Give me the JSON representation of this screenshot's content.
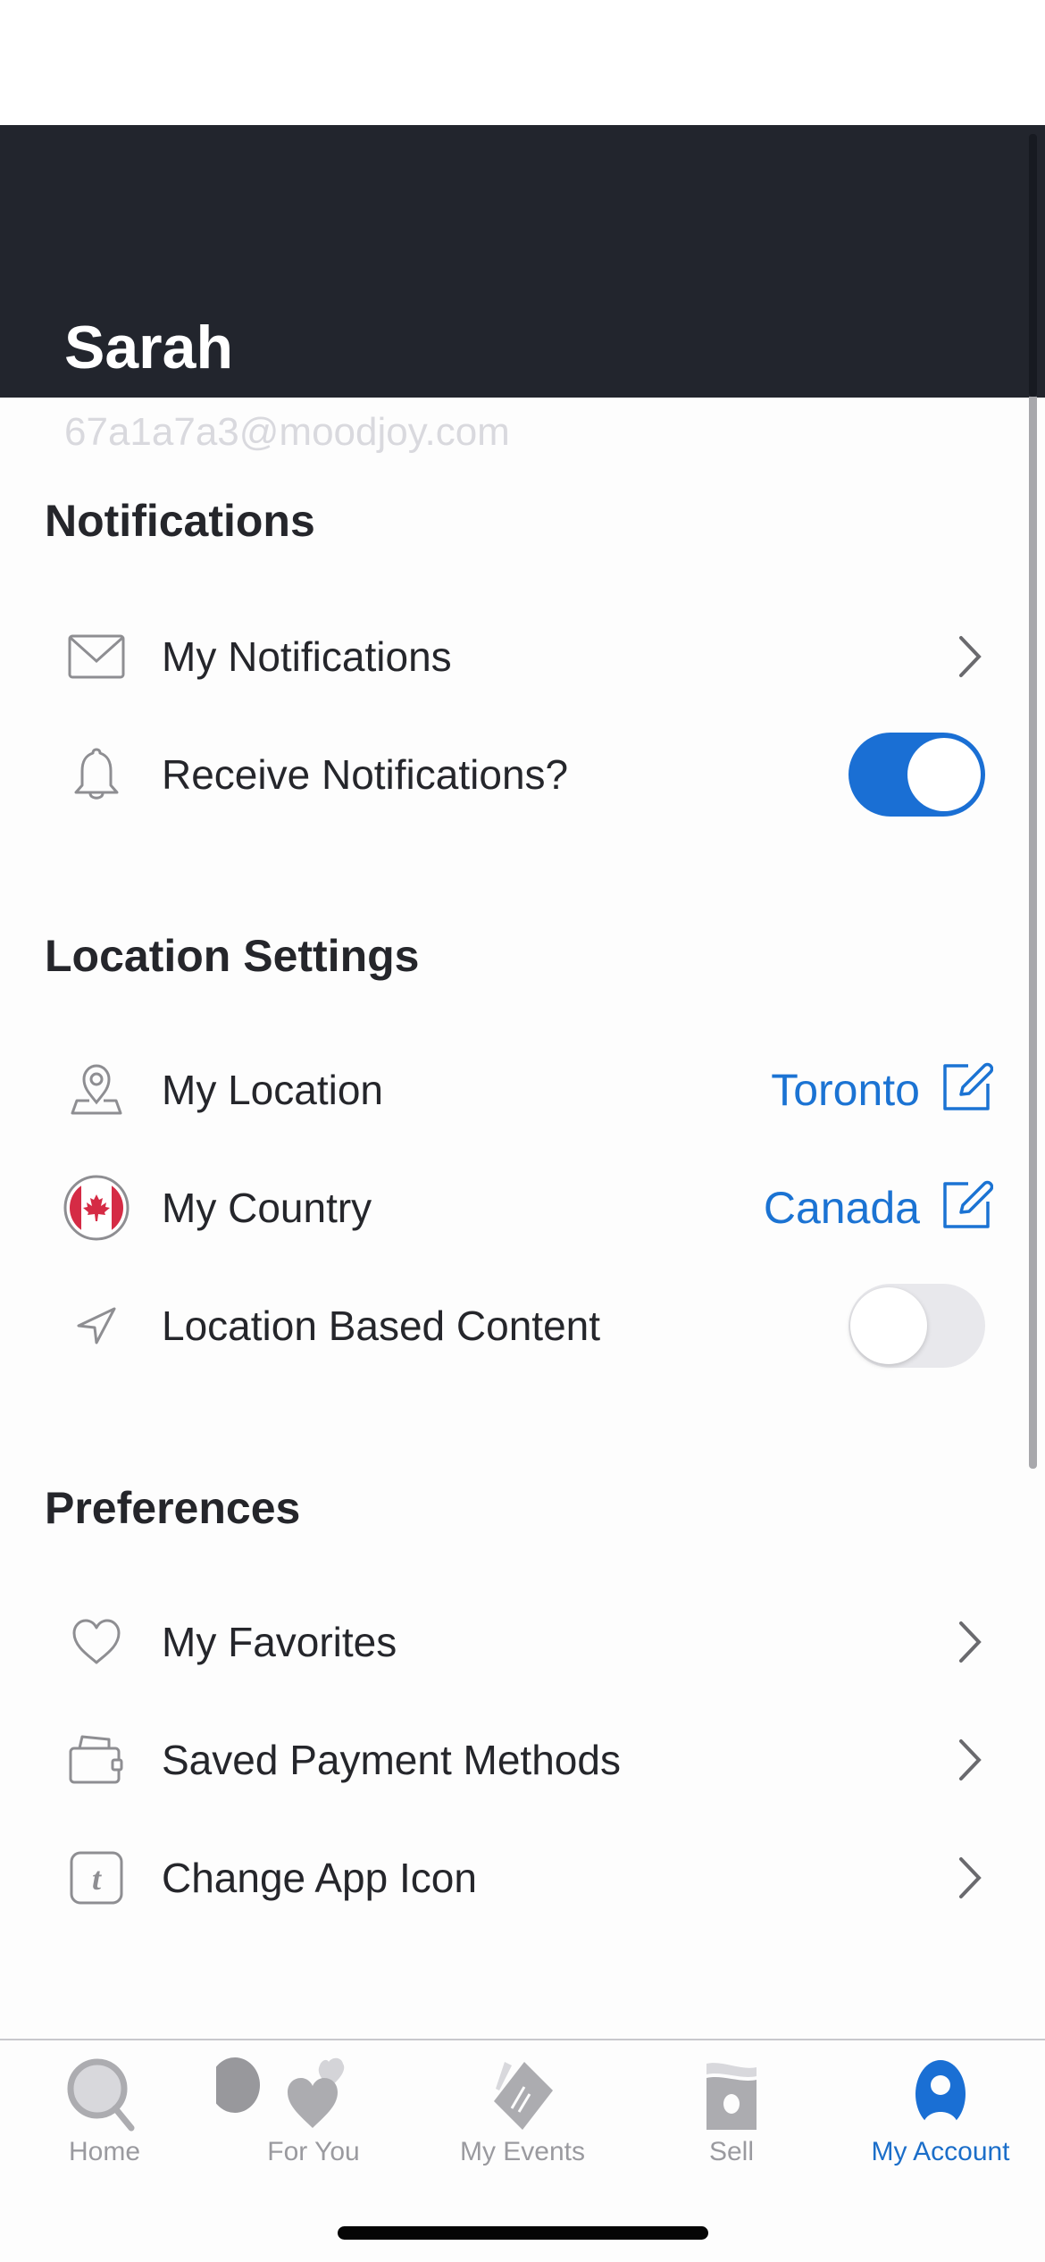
{
  "profile": {
    "name": "Sarah",
    "email": "67a1a7a3@moodjoy.com"
  },
  "colors": {
    "header_bg": "#22252d",
    "accent": "#1a6fd4",
    "icon_gray": "#8e8e92",
    "canada_red": "#d52b45"
  },
  "sections": [
    {
      "heading": "Notifications",
      "rows": [
        {
          "label": "My Notifications",
          "icon": "envelope-icon",
          "control": "chevron"
        },
        {
          "label": "Receive Notifications?",
          "icon": "bell-icon",
          "control": "toggle",
          "toggle_on": true
        }
      ]
    },
    {
      "heading": "Location Settings",
      "rows": [
        {
          "label": "My Location",
          "icon": "map-pin-icon",
          "control": "edit",
          "value": "Toronto"
        },
        {
          "label": "My Country",
          "icon": "canada-flag-icon",
          "control": "edit",
          "value": "Canada"
        },
        {
          "label": "Location Based Content",
          "icon": "navigation-arrow-icon",
          "control": "toggle",
          "toggle_on": false
        }
      ]
    },
    {
      "heading": "Preferences",
      "rows": [
        {
          "label": "My Favorites",
          "icon": "heart-icon",
          "control": "chevron"
        },
        {
          "label": "Saved Payment Methods",
          "icon": "wallet-icon",
          "control": "chevron"
        },
        {
          "label": "Change App Icon",
          "icon": "app-icon-t-icon",
          "control": "chevron"
        }
      ]
    }
  ],
  "tabbar": {
    "tabs": [
      {
        "label": "Home",
        "icon": "search-icon",
        "active": false
      },
      {
        "label": "For You",
        "icon": "hearts-icon",
        "active": false
      },
      {
        "label": "My Events",
        "icon": "ticket-icon",
        "active": false
      },
      {
        "label": "Sell",
        "icon": "money-icon",
        "active": false
      },
      {
        "label": "My Account",
        "icon": "account-icon",
        "active": true
      }
    ]
  }
}
